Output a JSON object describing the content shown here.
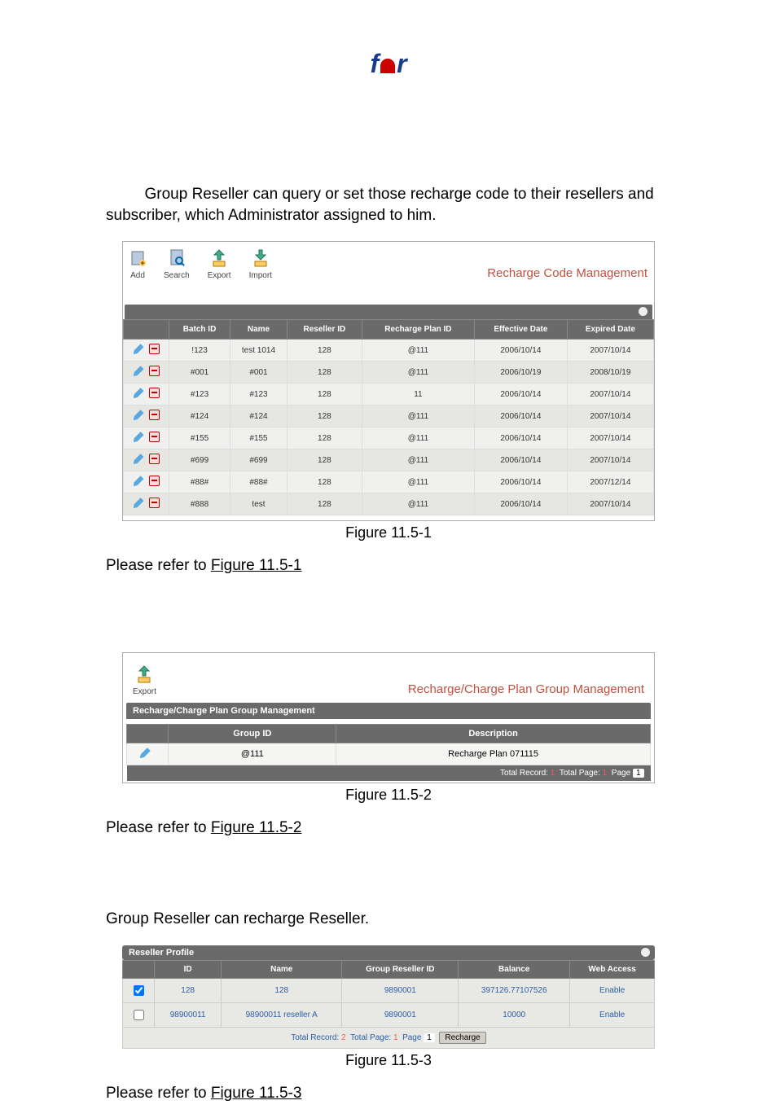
{
  "logo": "fm",
  "para1": "Group Reseller can query or set those recharge code to their resellers and subscriber, which Administrator assigned to him.",
  "fig1": {
    "tb": {
      "add": "Add",
      "search": "Search",
      "export": "Export",
      "import": "Import"
    },
    "title": "Recharge Code Management",
    "cols": [
      "",
      "Batch ID",
      "Name",
      "Reseller ID",
      "Recharge Plan ID",
      "Effective Date",
      "Expired Date"
    ],
    "rows": [
      [
        "!123",
        "test 1014",
        "128",
        "@111",
        "2006/10/14",
        "2007/10/14"
      ],
      [
        "#001",
        "#001",
        "128",
        "@111",
        "2006/10/19",
        "2008/10/19"
      ],
      [
        "#123",
        "#123",
        "128",
        "11",
        "2006/10/14",
        "2007/10/14"
      ],
      [
        "#124",
        "#124",
        "128",
        "@111",
        "2006/10/14",
        "2007/10/14"
      ],
      [
        "#155",
        "#155",
        "128",
        "@111",
        "2006/10/14",
        "2007/10/14"
      ],
      [
        "#699",
        "#699",
        "128",
        "@111",
        "2006/10/14",
        "2007/10/14"
      ],
      [
        "#88#",
        "#88#",
        "128",
        "@111",
        "2006/10/14",
        "2007/12/14"
      ],
      [
        "#888",
        "test",
        "128",
        "@111",
        "2006/10/14",
        "2007/10/14"
      ]
    ],
    "cap": "Figure 11.5-1"
  },
  "refer1": {
    "pre": "Please refer to ",
    "link": "Figure 11.5-1"
  },
  "fig2": {
    "tb": {
      "export": "Export"
    },
    "title": "Recharge/Charge Plan Group Management",
    "hdr": "Recharge/Charge Plan Group Management",
    "cols": [
      "",
      "Group ID",
      "Description"
    ],
    "row": [
      "@111",
      "Recharge Plan 071115"
    ],
    "footer": {
      "tr": "Total Record:",
      "tr_v": "1",
      "tp": "Total Page:",
      "tp_v": "1",
      "pg": "Page",
      "pg_v": "1"
    },
    "cap": "Figure 11.5-2"
  },
  "refer2": {
    "pre": "Please refer to ",
    "link": "Figure 11.5-2"
  },
  "para3": "Group Reseller can recharge Reseller.",
  "fig3": {
    "hdr": "Reseller Profile",
    "cols": [
      "",
      "ID",
      "Name",
      "Group Reseller ID",
      "Balance",
      "Web Access"
    ],
    "rows": [
      {
        "chk": true,
        "v": [
          "128",
          "128",
          "9890001",
          "397126.77107526",
          "Enable"
        ]
      },
      {
        "chk": false,
        "v": [
          "98900011",
          "98900011 reseller A",
          "9890001",
          "10000",
          "Enable"
        ]
      }
    ],
    "footer": {
      "tr": "Total Record:",
      "tr_v": "2",
      "tp": "Total Page:",
      "tp_v": "1",
      "pg": "Page",
      "pg_v": "1",
      "btn": "Recharge"
    },
    "cap": "Figure 11.5-3"
  },
  "refer3": {
    "pre": "Please refer to ",
    "link": "Figure 11.5-3"
  }
}
